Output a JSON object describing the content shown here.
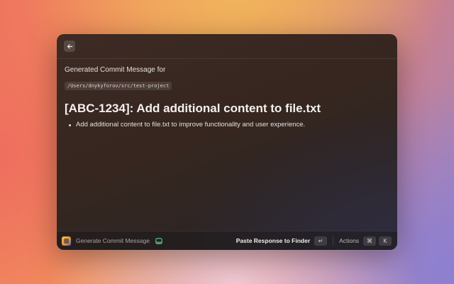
{
  "header": {
    "back_icon": "arrow-left-icon"
  },
  "main": {
    "subtitle": "Generated Commit Message for",
    "repo_path": "/Users/dnykyforov/src/test-project",
    "commit_title": "[ABC-1234]: Add additional content to file.txt",
    "bullets": [
      "Add additional content to file.txt to improve functionality and user experience."
    ]
  },
  "footer": {
    "command_name": "Generate Commit Message",
    "primary_action": "Paste Response to Finder",
    "primary_shortcut": "↵",
    "actions_label": "Actions",
    "actions_shortcut_mod": "⌘",
    "actions_shortcut_key": "K"
  },
  "colors": {
    "window_bg": "#36261f",
    "accent_ai": "#5fcf8e"
  }
}
